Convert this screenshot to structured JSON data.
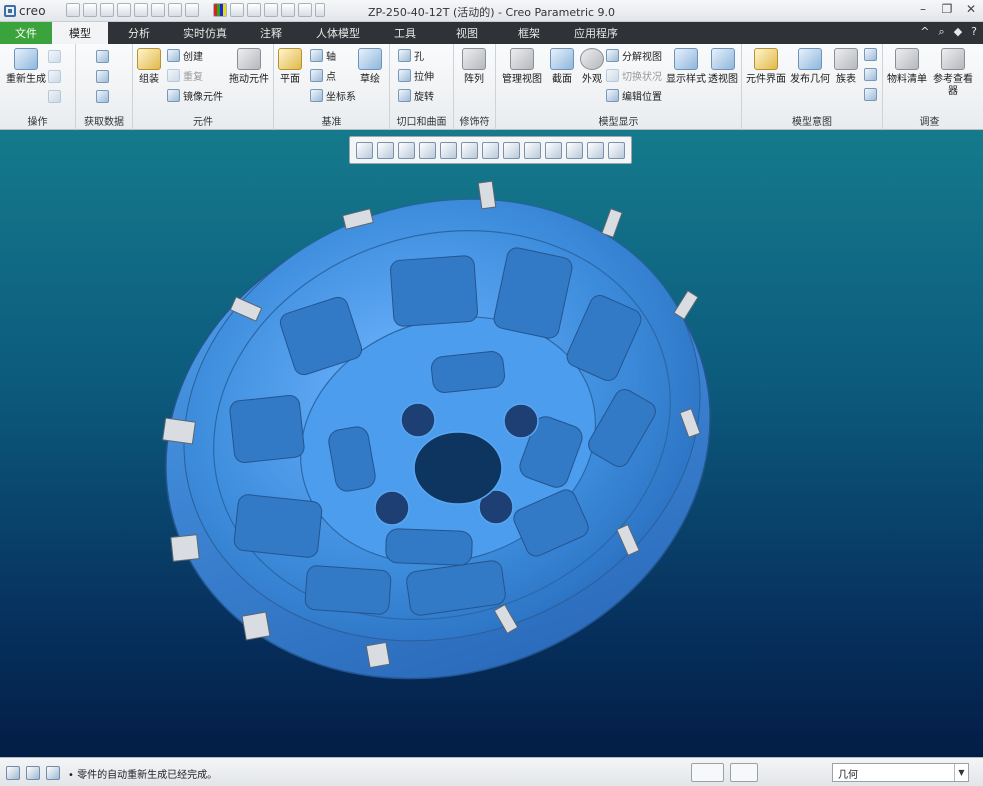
{
  "app": {
    "logo": "creo",
    "window_title": "ZP-250-40-12T (活动的) - Creo Parametric 9.0",
    "window_controls": [
      "–",
      "❐",
      "✕"
    ]
  },
  "menu": {
    "tabs": [
      "文件",
      "模型",
      "分析",
      "实时仿真",
      "注释",
      "人体模型",
      "工具",
      "视图",
      "框架",
      "应用程序"
    ],
    "active_tab": "模型",
    "right_icons": [
      "^",
      "⌕",
      "◆",
      "?"
    ]
  },
  "ribbon": {
    "groups": {
      "operations": "操作",
      "get_data": "获取数据",
      "components": "元件",
      "datum": "基准",
      "cut_surface": "切口和曲面",
      "modifiers": "修饰符",
      "model_display": "模型显示",
      "model_intent": "模型意图",
      "investigate": "调查"
    },
    "buttons": {
      "regenerate": "重新生成",
      "assemble": "组装",
      "create": "创建",
      "repeat": "重复",
      "mirror_component": "镜像元件",
      "drag_components": "拖动元件",
      "plane": "平面",
      "axis": "轴",
      "point": "点",
      "coord_sys": "坐标系",
      "sketch": "草绘",
      "hole": "孔",
      "extrude": "拉伸",
      "revolve": "旋转",
      "pattern": "阵列",
      "manage_views": "管理视图",
      "section": "截面",
      "appearance": "外观",
      "explode_view": "分解视图",
      "toggle_status": "切换状况",
      "edit_position": "编辑位置",
      "display_style": "显示样式",
      "perspective": "透视图",
      "component_interface": "元件界面",
      "publish_geometry": "发布几何",
      "family_table": "族表",
      "bom": "物料清单",
      "reference_viewer": "参考查看器"
    }
  },
  "status": {
    "message": "• 零件的自动重新生成已经完成。",
    "filter_value": "几何"
  },
  "colors": {
    "model_blue": "#3f8fde",
    "file_tab_green": "#3aa33b",
    "menu_dark": "#2f3236"
  }
}
